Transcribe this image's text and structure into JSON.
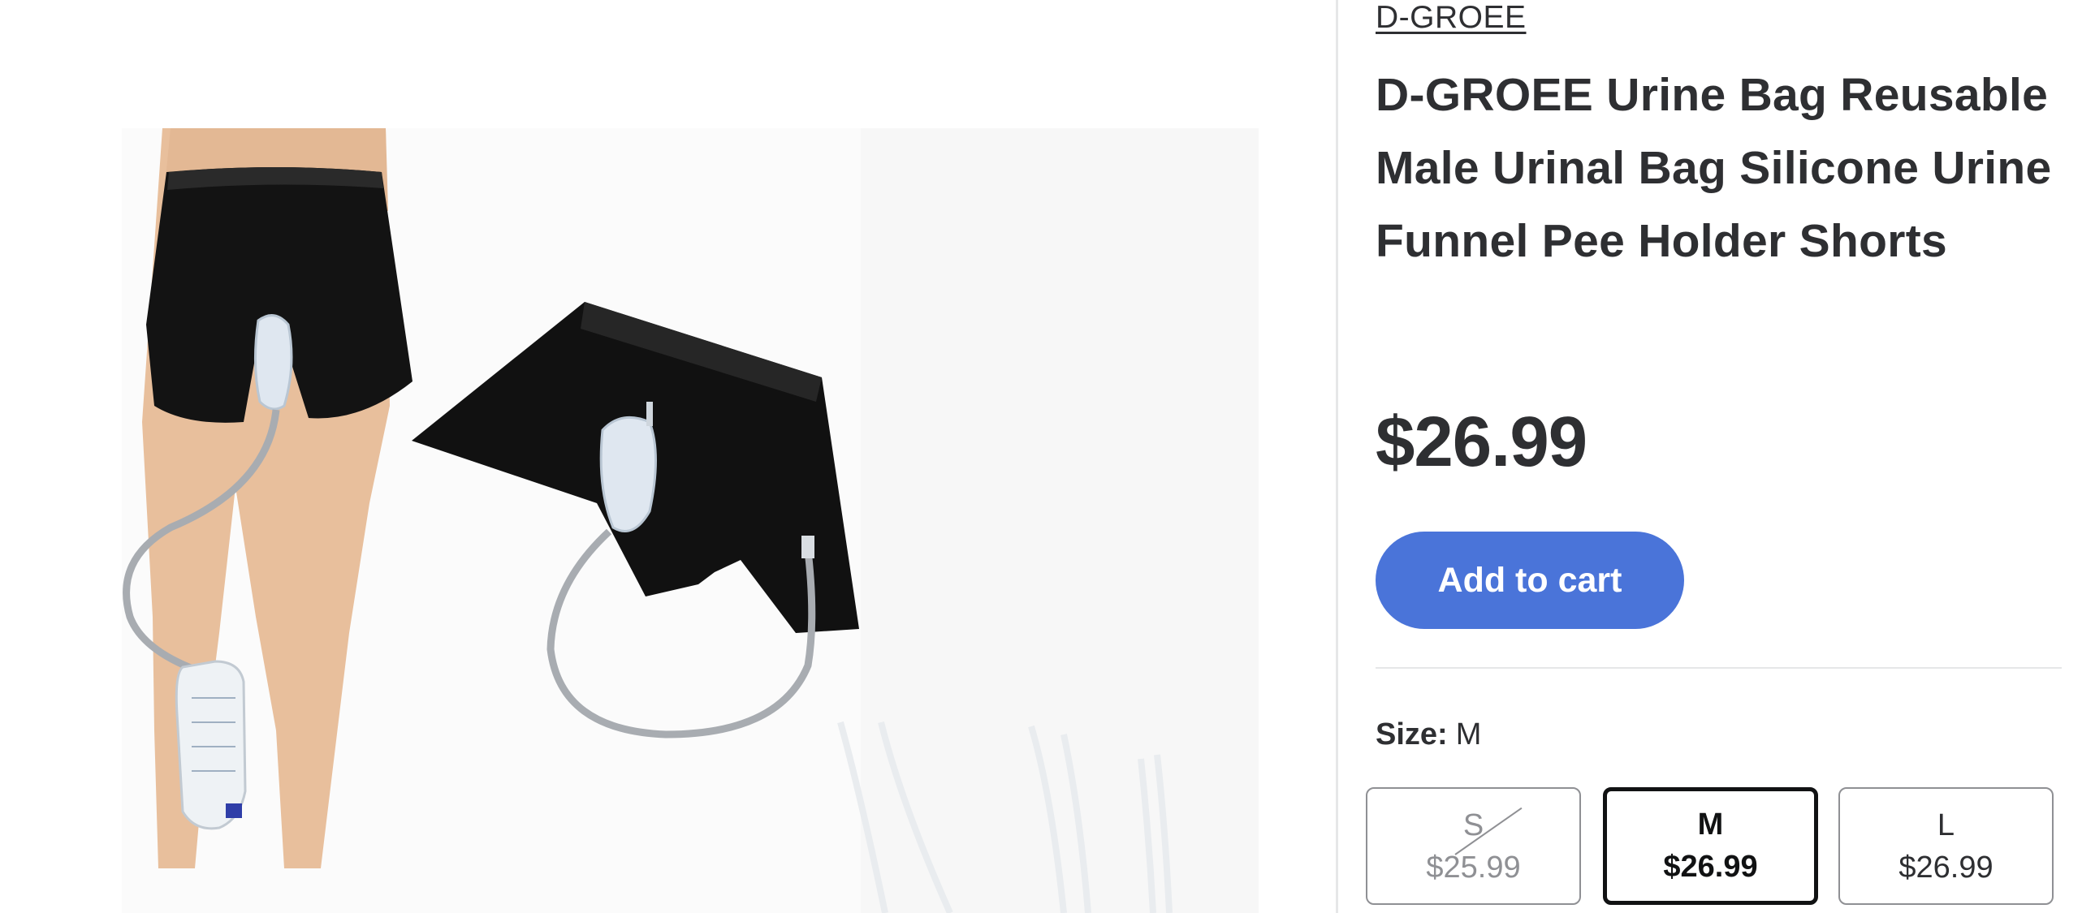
{
  "product": {
    "brand": "D-GROEE",
    "title": "D-GROEE Urine Bag Reusable Male Urinal Bag Silicone Urine Funnel Pee Holder Shorts",
    "price": "$26.99",
    "image_alt": "Urine bag shorts product image"
  },
  "actions": {
    "add_to_cart": "Add to cart"
  },
  "size": {
    "label": "Size:",
    "selected": "M",
    "options": [
      {
        "name": "S",
        "price": "$25.99",
        "available": false
      },
      {
        "name": "M",
        "price": "$26.99",
        "available": true
      },
      {
        "name": "L",
        "price": "$26.99",
        "available": true
      }
    ]
  },
  "colors": {
    "accent": "#4a74d9",
    "text": "#2e2f32",
    "muted": "#8f9094"
  }
}
